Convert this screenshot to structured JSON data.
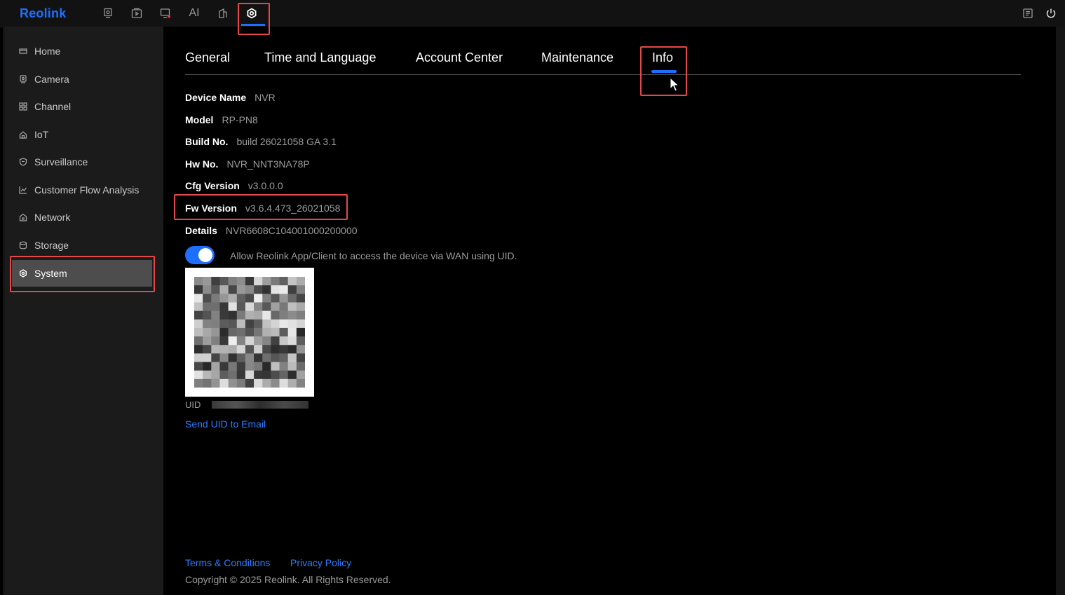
{
  "app": {
    "logo_text": "Reolink"
  },
  "topbar": {
    "icons": [
      "preview-icon",
      "playback-icon",
      "alarm-icon",
      "ai-icon",
      "device-icon",
      "settings-icon",
      "notes-icon",
      "power-icon"
    ],
    "ai_label": "AI"
  },
  "sidebar": {
    "items": [
      {
        "label": "Home",
        "icon": "home-icon"
      },
      {
        "label": "Camera",
        "icon": "camera-icon"
      },
      {
        "label": "Channel",
        "icon": "channel-icon"
      },
      {
        "label": "IoT",
        "icon": "iot-icon"
      },
      {
        "label": "Surveillance",
        "icon": "surveillance-icon"
      },
      {
        "label": "Customer Flow Analysis",
        "icon": "chart-icon"
      },
      {
        "label": "Network",
        "icon": "network-icon"
      },
      {
        "label": "Storage",
        "icon": "storage-icon"
      },
      {
        "label": "System",
        "icon": "system-icon",
        "selected": true
      }
    ]
  },
  "tabs": [
    {
      "label": "General"
    },
    {
      "label": "Time and Language"
    },
    {
      "label": "Account Center"
    },
    {
      "label": "Maintenance"
    },
    {
      "label": "Info",
      "active": true
    }
  ],
  "info": {
    "device_name": {
      "label": "Device Name",
      "value": "NVR"
    },
    "model": {
      "label": "Model",
      "value": "RP-PN8"
    },
    "build_no": {
      "label": "Build No.",
      "value": "build 26021058 GA 3.1"
    },
    "hw_no": {
      "label": "Hw No.",
      "value": "NVR_NNT3NA78P"
    },
    "cfg_version": {
      "label": "Cfg Version",
      "value": "v3.0.0.0"
    },
    "fw_version": {
      "label": "Fw Version",
      "value": "v3.6.4.473_26021058"
    },
    "details": {
      "label": "Details",
      "value": "NVR6608C104001000200000"
    }
  },
  "uid_access": {
    "toggle_on": true,
    "label": "Allow Reolink App/Client to access the device via WAN using UID."
  },
  "uid": {
    "label": "UID",
    "send_link": "Send UID to Email"
  },
  "footer": {
    "terms": "Terms & Conditions",
    "privacy": "Privacy Policy",
    "copyright": "Copyright © 2025 Reolink. All Rights Reserved."
  },
  "colors": {
    "accent": "#1e6fff",
    "highlight_box": "#e84747",
    "sidebar_selected": "#4d4d4d"
  }
}
